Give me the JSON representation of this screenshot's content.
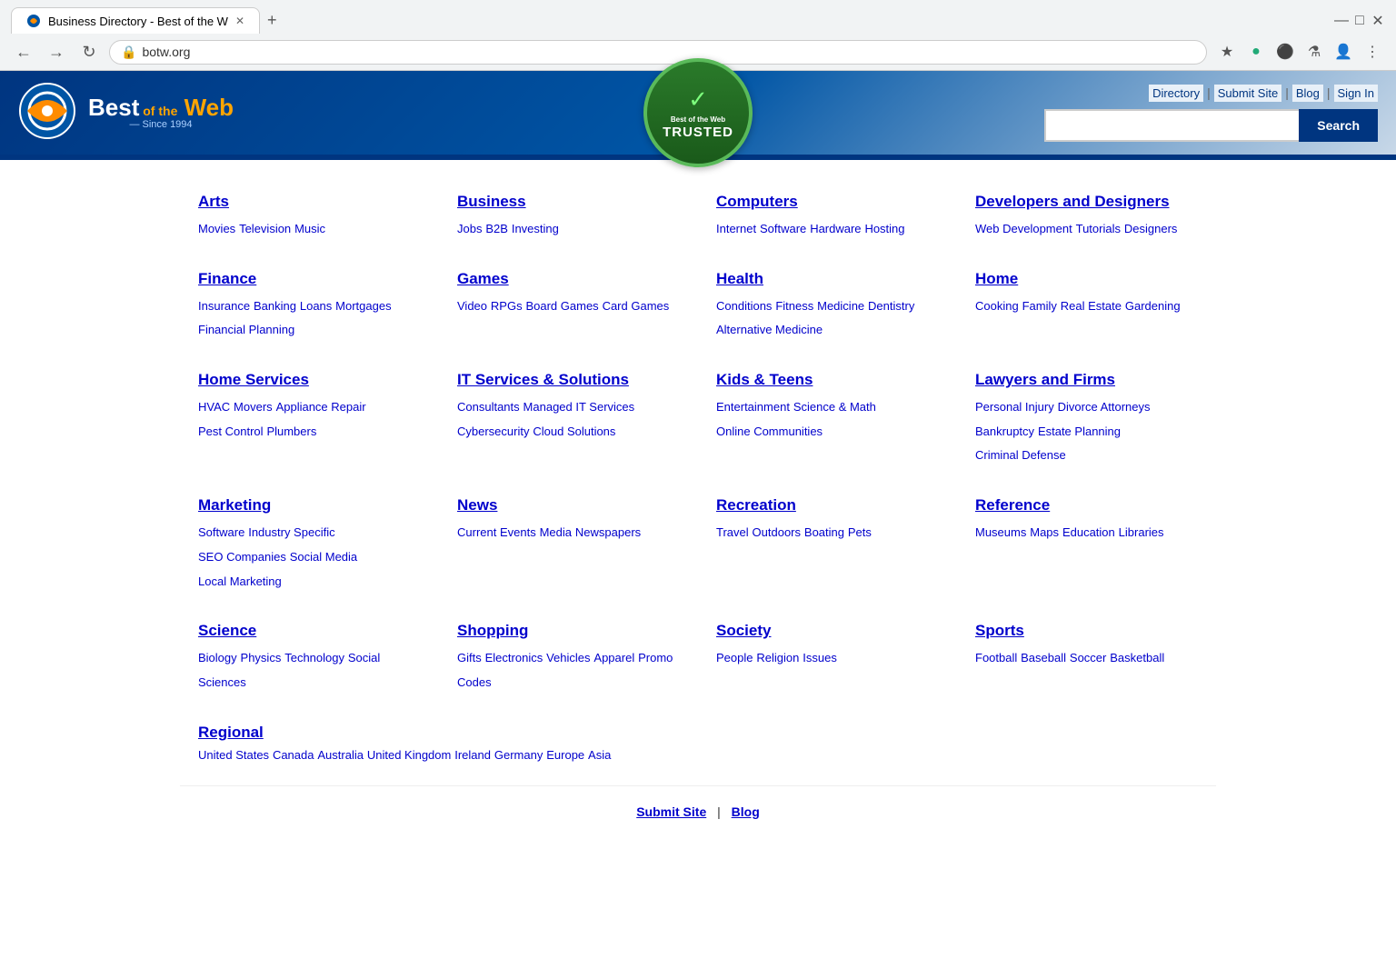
{
  "browser": {
    "tab_title": "Business Directory - Best of the W",
    "url": "botw.org",
    "new_tab_label": "+",
    "nav": {
      "back": "←",
      "forward": "→",
      "reload": "↻"
    }
  },
  "header": {
    "logo_best": "Best",
    "logo_of": "of the",
    "logo_web": "Web",
    "logo_since": "— Since 1994",
    "trusted_brand": "Best of the Web",
    "trusted_label": "TRUSTED",
    "nav_links": [
      "Directory",
      "Submit Site",
      "Blog",
      "Sign In"
    ],
    "search_placeholder": "",
    "search_button": "Search"
  },
  "categories": [
    {
      "id": "arts",
      "title": "Arts",
      "subs": [
        "Movies",
        "Television",
        "Music"
      ]
    },
    {
      "id": "business",
      "title": "Business",
      "subs": [
        "Jobs",
        "B2B",
        "Investing"
      ]
    },
    {
      "id": "computers",
      "title": "Computers",
      "subs": [
        "Internet",
        "Software",
        "Hardware",
        "Hosting"
      ]
    },
    {
      "id": "developers",
      "title": "Developers and Designers",
      "subs": [
        "Web Development",
        "Tutorials",
        "Designers"
      ]
    },
    {
      "id": "finance",
      "title": "Finance",
      "subs": [
        "Insurance",
        "Banking",
        "Loans",
        "Mortgages",
        "Financial Planning"
      ]
    },
    {
      "id": "games",
      "title": "Games",
      "subs": [
        "Video",
        "RPGs",
        "Board Games",
        "Card Games"
      ]
    },
    {
      "id": "health",
      "title": "Health",
      "subs": [
        "Conditions",
        "Fitness",
        "Medicine",
        "Dentistry",
        "Alternative Medicine"
      ]
    },
    {
      "id": "home",
      "title": "Home",
      "subs": [
        "Cooking",
        "Family",
        "Real Estate",
        "Gardening"
      ]
    },
    {
      "id": "home-services",
      "title": "Home Services",
      "subs": [
        "HVAC",
        "Movers",
        "Appliance Repair",
        "Pest Control",
        "Plumbers"
      ]
    },
    {
      "id": "it-services",
      "title": "IT Services & Solutions",
      "subs": [
        "Consultants",
        "Managed IT Services",
        "Cybersecurity",
        "Cloud Solutions"
      ]
    },
    {
      "id": "kids-teens",
      "title": "Kids & Teens",
      "subs": [
        "Entertainment",
        "Science & Math",
        "Online Communities"
      ]
    },
    {
      "id": "lawyers",
      "title": "Lawyers and Firms",
      "subs": [
        "Personal Injury",
        "Divorce Attorneys",
        "Bankruptcy",
        "Estate Planning",
        "Criminal Defense"
      ]
    },
    {
      "id": "marketing",
      "title": "Marketing",
      "subs": [
        "Software",
        "Industry Specific",
        "SEO Companies",
        "Social Media",
        "Local Marketing"
      ]
    },
    {
      "id": "news",
      "title": "News",
      "subs": [
        "Current Events",
        "Media",
        "Newspapers"
      ]
    },
    {
      "id": "recreation",
      "title": "Recreation",
      "subs": [
        "Travel",
        "Outdoors",
        "Boating",
        "Pets"
      ]
    },
    {
      "id": "reference",
      "title": "Reference",
      "subs": [
        "Museums",
        "Maps",
        "Education",
        "Libraries"
      ]
    },
    {
      "id": "science",
      "title": "Science",
      "subs": [
        "Biology",
        "Physics",
        "Technology",
        "Social Sciences"
      ]
    },
    {
      "id": "shopping",
      "title": "Shopping",
      "subs": [
        "Gifts",
        "Electronics",
        "Vehicles",
        "Apparel",
        "Promo Codes"
      ]
    },
    {
      "id": "society",
      "title": "Society",
      "subs": [
        "People",
        "Religion",
        "Issues"
      ]
    },
    {
      "id": "sports",
      "title": "Sports",
      "subs": [
        "Football",
        "Baseball",
        "Soccer",
        "Basketball"
      ]
    },
    {
      "id": "regional",
      "title": "Regional",
      "subs": [
        "United States",
        "Canada",
        "Australia",
        "United Kingdom",
        "Ireland",
        "Germany",
        "Europe",
        "Asia"
      ],
      "full_width": true
    }
  ],
  "footer": {
    "submit_site": "Submit Site",
    "blog": "Blog",
    "separator": "|"
  }
}
